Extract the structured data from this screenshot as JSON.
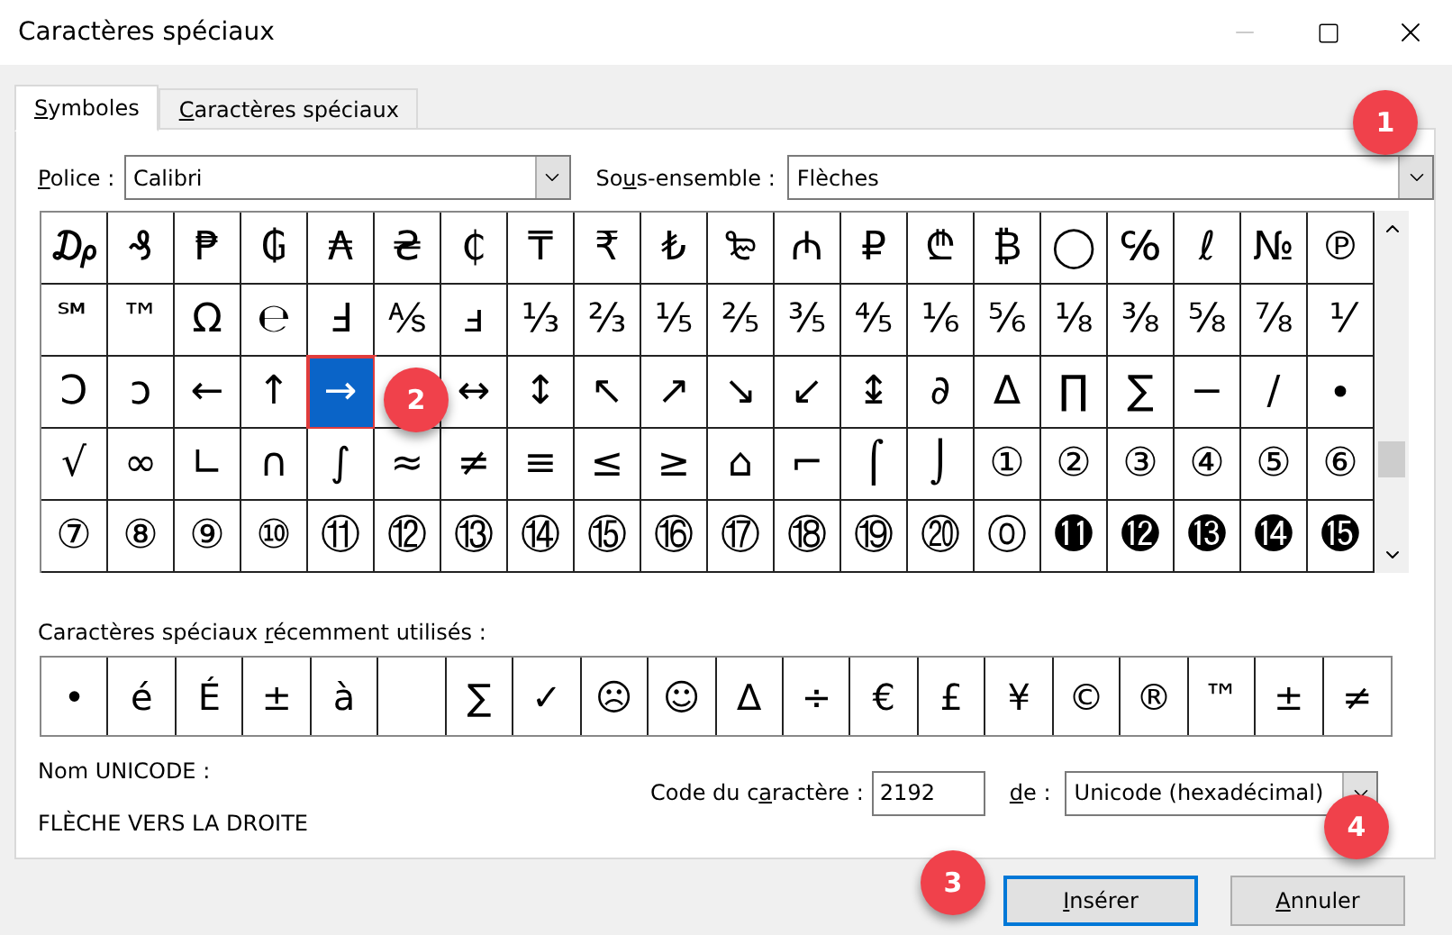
{
  "window": {
    "title": "Caractères spéciaux"
  },
  "tabs": [
    {
      "label": {
        "key": "S",
        "post": "ymboles"
      },
      "selected": true
    },
    {
      "label": {
        "key": "C",
        "post": "aractères spéciaux"
      },
      "selected": false
    }
  ],
  "font": {
    "label": {
      "key": "P",
      "post": "olice :"
    },
    "value": "Calibri"
  },
  "subset": {
    "label": {
      "pre": "So",
      "key": "u",
      "post": "s-ensemble :"
    },
    "value": "Flèches"
  },
  "grid": [
    [
      {
        "char": "₯",
        "selected": false
      },
      {
        "char": "₰",
        "selected": false
      },
      {
        "char": "₱",
        "selected": false
      },
      {
        "char": "₲",
        "selected": false
      },
      {
        "char": "₳",
        "selected": false
      },
      {
        "char": "₴",
        "selected": false
      },
      {
        "char": "₵",
        "selected": false
      },
      {
        "char": "₸",
        "selected": false
      },
      {
        "char": "₹",
        "selected": false
      },
      {
        "char": "₺",
        "selected": false
      },
      {
        "char": "₻",
        "selected": false
      },
      {
        "char": "₼",
        "selected": false
      },
      {
        "char": "₽",
        "selected": false
      },
      {
        "char": "₾",
        "selected": false
      },
      {
        "char": "₿",
        "selected": false
      },
      {
        "char": "◯",
        "selected": false
      },
      {
        "char": "℅",
        "selected": false
      },
      {
        "char": "ℓ",
        "selected": false
      },
      {
        "char": "№",
        "selected": false
      },
      {
        "char": "℗",
        "selected": false
      }
    ],
    [
      {
        "char": "℠",
        "selected": false
      },
      {
        "char": "™",
        "selected": false
      },
      {
        "char": "Ω",
        "selected": false
      },
      {
        "char": "℮",
        "selected": false
      },
      {
        "char": "Ⅎ",
        "selected": false
      },
      {
        "char": "⅍",
        "selected": false
      },
      {
        "char": "ⅎ",
        "selected": false
      },
      {
        "char": "⅓",
        "selected": false
      },
      {
        "char": "⅔",
        "selected": false
      },
      {
        "char": "⅕",
        "selected": false
      },
      {
        "char": "⅖",
        "selected": false
      },
      {
        "char": "⅗",
        "selected": false
      },
      {
        "char": "⅘",
        "selected": false
      },
      {
        "char": "⅙",
        "selected": false
      },
      {
        "char": "⅚",
        "selected": false
      },
      {
        "char": "⅛",
        "selected": false
      },
      {
        "char": "⅜",
        "selected": false
      },
      {
        "char": "⅝",
        "selected": false
      },
      {
        "char": "⅞",
        "selected": false
      },
      {
        "char": "⅟",
        "selected": false
      }
    ],
    [
      {
        "char": "Ↄ",
        "selected": false
      },
      {
        "char": "ↄ",
        "selected": false
      },
      {
        "char": "←",
        "selected": false
      },
      {
        "char": "↑",
        "selected": false
      },
      {
        "char": "→",
        "selected": true
      },
      {
        "selected": false
      },
      {
        "char": "↔",
        "selected": false
      },
      {
        "char": "↕",
        "selected": false
      },
      {
        "char": "↖",
        "selected": false
      },
      {
        "char": "↗",
        "selected": false
      },
      {
        "char": "↘",
        "selected": false
      },
      {
        "char": "↙",
        "selected": false
      },
      {
        "char": "↨",
        "selected": false
      },
      {
        "char": "∂",
        "selected": false
      },
      {
        "char": "∆",
        "selected": false
      },
      {
        "char": "∏",
        "selected": false
      },
      {
        "char": "∑",
        "selected": false
      },
      {
        "char": "−",
        "selected": false
      },
      {
        "char": "∕",
        "selected": false
      },
      {
        "char": "∙",
        "selected": false
      }
    ],
    [
      {
        "char": "√",
        "selected": false
      },
      {
        "char": "∞",
        "selected": false
      },
      {
        "char": "∟",
        "selected": false
      },
      {
        "char": "∩",
        "selected": false
      },
      {
        "char": "∫",
        "selected": false
      },
      {
        "char": "≈",
        "selected": false
      },
      {
        "char": "≠",
        "selected": false
      },
      {
        "char": "≡",
        "selected": false
      },
      {
        "char": "≤",
        "selected": false
      },
      {
        "char": "≥",
        "selected": false
      },
      {
        "char": "⌂",
        "selected": false
      },
      {
        "char": "⌐",
        "selected": false
      },
      {
        "char": "⌠",
        "selected": false
      },
      {
        "char": "⌡",
        "selected": false
      },
      {
        "char": "①",
        "selected": false
      },
      {
        "char": "②",
        "selected": false
      },
      {
        "char": "③",
        "selected": false
      },
      {
        "char": "④",
        "selected": false
      },
      {
        "char": "⑤",
        "selected": false
      },
      {
        "char": "⑥",
        "selected": false
      }
    ],
    [
      {
        "char": "⑦",
        "selected": false
      },
      {
        "char": "⑧",
        "selected": false
      },
      {
        "char": "⑨",
        "selected": false
      },
      {
        "char": "⑩",
        "selected": false
      },
      {
        "char": "⑪",
        "selected": false
      },
      {
        "char": "⑫",
        "selected": false
      },
      {
        "char": "⑬",
        "selected": false
      },
      {
        "char": "⑭",
        "selected": false
      },
      {
        "char": "⑮",
        "selected": false
      },
      {
        "char": "⑯",
        "selected": false
      },
      {
        "char": "⑰",
        "selected": false
      },
      {
        "char": "⑱",
        "selected": false
      },
      {
        "char": "⑲",
        "selected": false
      },
      {
        "char": "⑳",
        "selected": false
      },
      {
        "char": "⓪",
        "selected": false
      },
      {
        "char": "⓫",
        "selected": false
      },
      {
        "char": "⓬",
        "selected": false
      },
      {
        "char": "⓭",
        "selected": false
      },
      {
        "char": "⓮",
        "selected": false
      },
      {
        "char": "⓯",
        "selected": false
      }
    ]
  ],
  "recent": {
    "label": {
      "pre": "Caractères spéciaux ",
      "key": "r",
      "post": "écemment utilisés :"
    },
    "chars": [
      {
        "kind": "symbol",
        "char": "•"
      },
      {
        "kind": "symbol",
        "char": "é"
      },
      {
        "kind": "symbol",
        "char": "É"
      },
      {
        "kind": "symbol",
        "char": "±"
      },
      {
        "kind": "symbol",
        "char": "à"
      },
      {
        "kind": "blank"
      },
      {
        "kind": "symbol",
        "char": "∑"
      },
      {
        "kind": "symbol",
        "char": "✓"
      },
      {
        "kind": "symbol",
        "char": "☹"
      },
      {
        "kind": "symbol",
        "char": "☺"
      },
      {
        "kind": "symbol",
        "char": "∆"
      },
      {
        "kind": "symbol",
        "char": "÷"
      },
      {
        "kind": "symbol",
        "char": "€"
      },
      {
        "kind": "symbol",
        "char": "£"
      },
      {
        "kind": "symbol",
        "char": "¥"
      },
      {
        "kind": "symbol",
        "char": "©"
      },
      {
        "kind": "symbol",
        "char": "®"
      },
      {
        "kind": "symbol",
        "char": "™"
      },
      {
        "kind": "symbol",
        "char": "±"
      },
      {
        "kind": "symbol",
        "char": "≠"
      }
    ]
  },
  "unicode_name": {
    "label": "Nom UNICODE :",
    "value": "FLÈCHE VERS LA DROITE"
  },
  "char_code": {
    "label": {
      "pre": "Code du c",
      "key": "a",
      "post": "ractère :"
    },
    "value": "2192"
  },
  "from": {
    "label": {
      "key": "d",
      "post": "e :"
    },
    "value": "Unicode (hexadécimal)"
  },
  "buttons": [
    {
      "label": {
        "key": "I",
        "post": "nsérer"
      },
      "kind": "default"
    },
    {
      "label": {
        "key": "A",
        "post": "nnuler"
      },
      "kind": "normal"
    }
  ],
  "callouts": [
    "1",
    "2",
    "3",
    "4"
  ]
}
